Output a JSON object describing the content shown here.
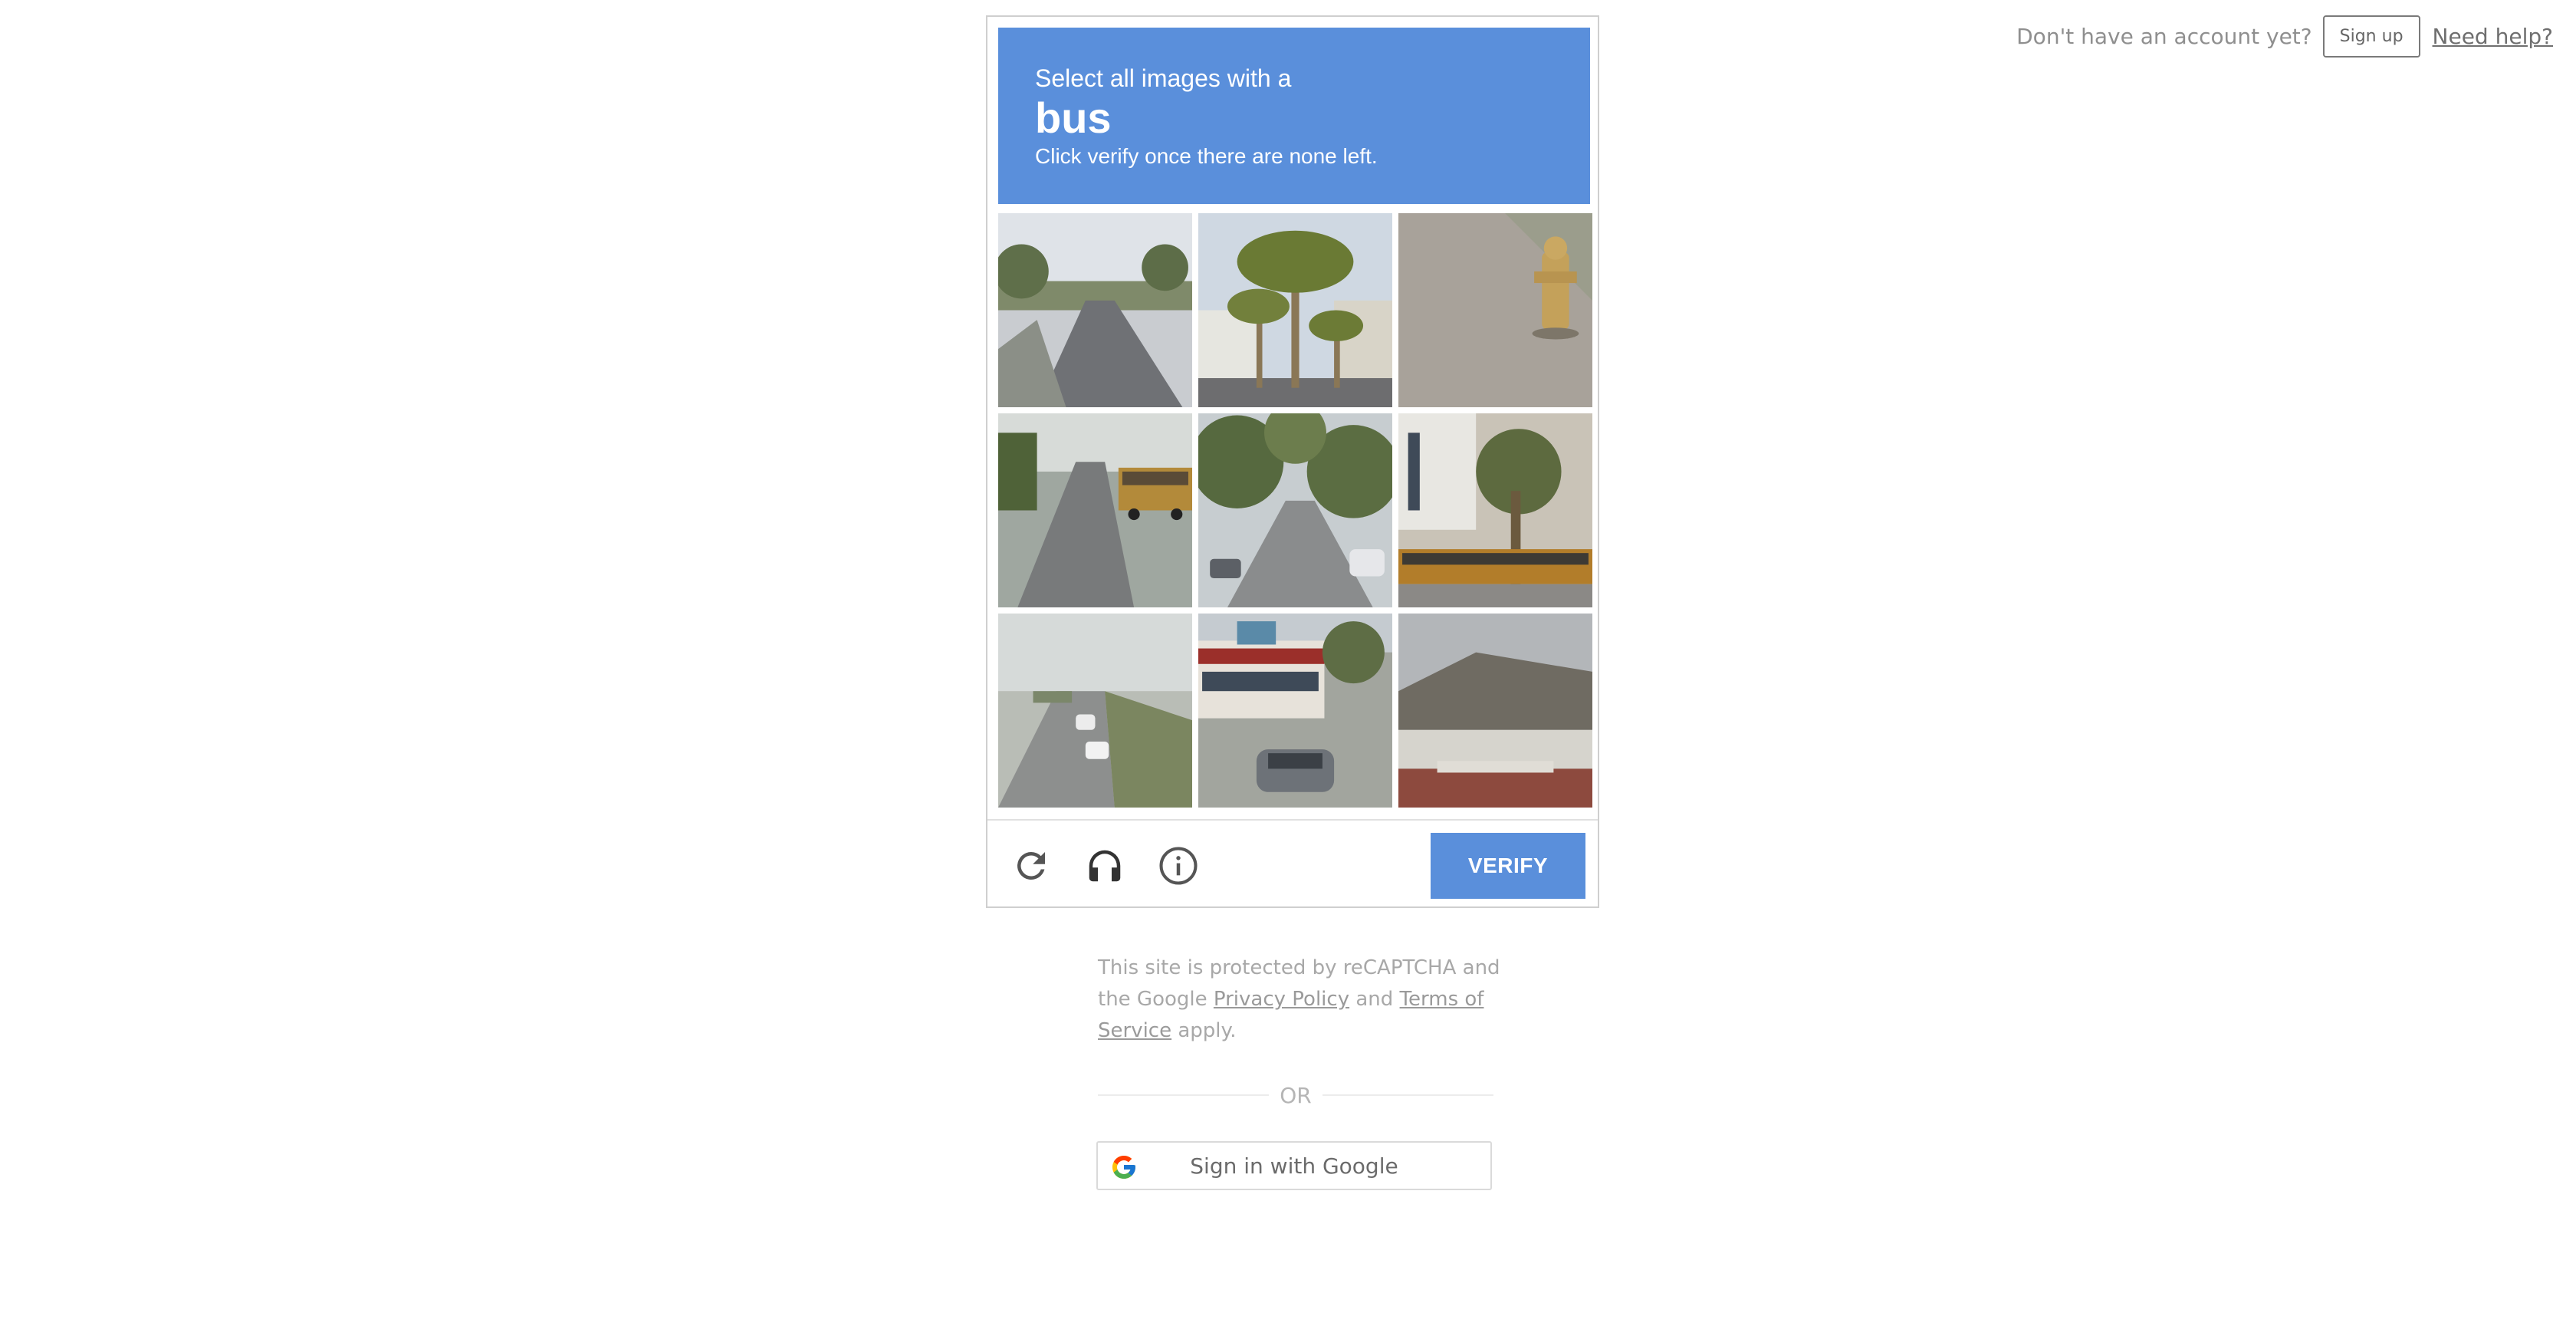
{
  "topbar": {
    "prompt": "Don't have an account yet?",
    "signup_label": "Sign up",
    "help_label": "Need help?"
  },
  "captcha": {
    "instruction": "Select all images with a",
    "keyword": "bus",
    "subtext": "Click verify once there are none left.",
    "tiles": [
      {
        "scene": "road with trees"
      },
      {
        "scene": "palm trees"
      },
      {
        "scene": "fire hydrant"
      },
      {
        "scene": "school bus on road"
      },
      {
        "scene": "tree-lined street"
      },
      {
        "scene": "school bus by building"
      },
      {
        "scene": "highway with cars"
      },
      {
        "scene": "bus and car"
      },
      {
        "scene": "house roof"
      }
    ],
    "footer": {
      "reload_icon": "reload-icon",
      "audio_icon": "headphones-icon",
      "info_icon": "info-icon",
      "verify_label": "VERIFY"
    },
    "colors": {
      "accent": "#5a8fdb"
    }
  },
  "legal": {
    "text_1": "This site is protected by reCAPTCHA and the Google ",
    "privacy": "Privacy Policy",
    "text_2": " and ",
    "terms": "Terms of Service",
    "text_3": " apply."
  },
  "divider": {
    "label": "OR"
  },
  "google_signin": {
    "label": "Sign in with Google",
    "icon": "google-logo-icon"
  }
}
